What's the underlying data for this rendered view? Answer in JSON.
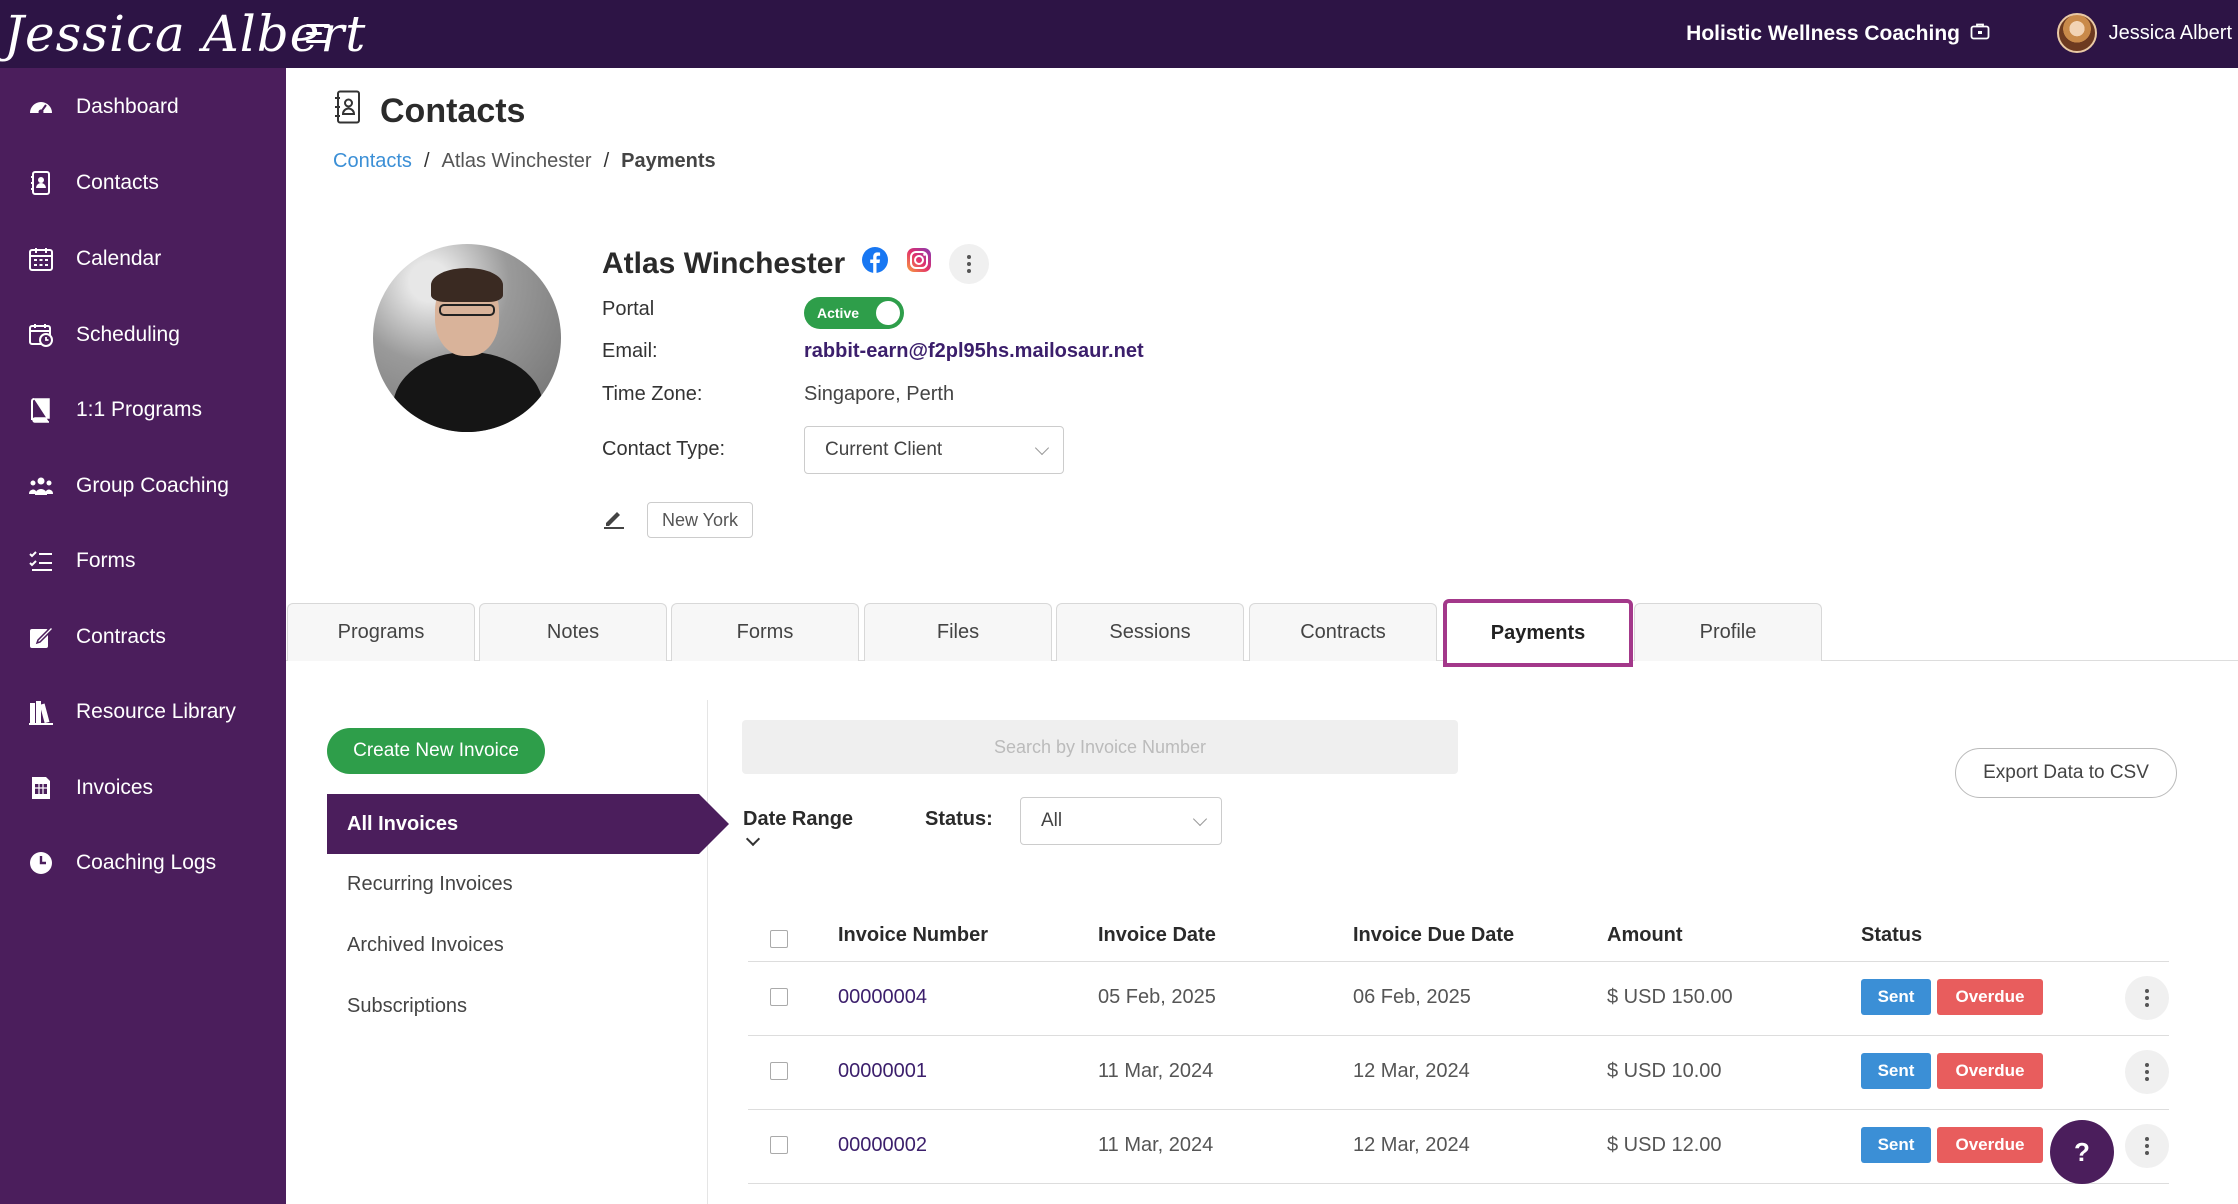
{
  "header": {
    "logo_text": "Jessica Albert",
    "business_name": "Holistic Wellness Coaching",
    "user_name": "Jessica Albert",
    "brand_color": "#2d1445",
    "sidebar_color": "#4b1e5c"
  },
  "sidebar": {
    "items": [
      {
        "label": "Dashboard",
        "icon": "dashboard-icon"
      },
      {
        "label": "Contacts",
        "icon": "contacts-icon"
      },
      {
        "label": "Calendar",
        "icon": "calendar-icon"
      },
      {
        "label": "Scheduling",
        "icon": "scheduling-icon"
      },
      {
        "label": "1:1 Programs",
        "icon": "book-icon"
      },
      {
        "label": "Group Coaching",
        "icon": "group-icon"
      },
      {
        "label": "Forms",
        "icon": "forms-icon"
      },
      {
        "label": "Contracts",
        "icon": "contract-icon"
      },
      {
        "label": "Resource Library",
        "icon": "library-icon"
      },
      {
        "label": "Invoices",
        "icon": "invoice-icon"
      },
      {
        "label": "Coaching Logs",
        "icon": "clock-icon"
      }
    ]
  },
  "page": {
    "title": "Contacts",
    "breadcrumbs": [
      "Contacts",
      "Atlas Winchester",
      "Payments"
    ]
  },
  "contact": {
    "name": "Atlas Winchester",
    "portal_label": "Portal",
    "portal_status": "Active",
    "email_label": "Email:",
    "email": "rabbit-earn@f2pl95hs.mailosaur.net",
    "timezone_label": "Time Zone:",
    "timezone": "Singapore, Perth",
    "contact_type_label": "Contact Type:",
    "contact_type": "Current Client",
    "tag": "New York"
  },
  "tabs": [
    {
      "label": "Programs"
    },
    {
      "label": "Notes"
    },
    {
      "label": "Forms"
    },
    {
      "label": "Files"
    },
    {
      "label": "Sessions"
    },
    {
      "label": "Contracts"
    },
    {
      "label": "Payments",
      "active": true
    },
    {
      "label": "Profile"
    }
  ],
  "payments": {
    "create_button": "Create New Invoice",
    "subnav": [
      "All Invoices",
      "Recurring Invoices",
      "Archived Invoices",
      "Subscriptions"
    ],
    "search_placeholder": "Search by Invoice Number",
    "export_button": "Export Data to CSV",
    "date_range_label": "Date Range",
    "status_label": "Status:",
    "status_value": "All",
    "columns": [
      "Invoice Number",
      "Invoice Date",
      "Invoice Due Date",
      "Amount",
      "Status"
    ],
    "rows": [
      {
        "number": "00000004",
        "date": "05 Feb, 2025",
        "due": "06 Feb, 2025",
        "amount": "$ USD 150.00",
        "status1": "Sent",
        "status2": "Overdue"
      },
      {
        "number": "00000001",
        "date": "11 Mar, 2024",
        "due": "12 Mar, 2024",
        "amount": "$ USD 10.00",
        "status1": "Sent",
        "status2": "Overdue"
      },
      {
        "number": "00000002",
        "date": "11 Mar, 2024",
        "due": "12 Mar, 2024",
        "amount": "$ USD 12.00",
        "status1": "Sent",
        "status2": "Overdue"
      }
    ]
  },
  "help_button": "?"
}
